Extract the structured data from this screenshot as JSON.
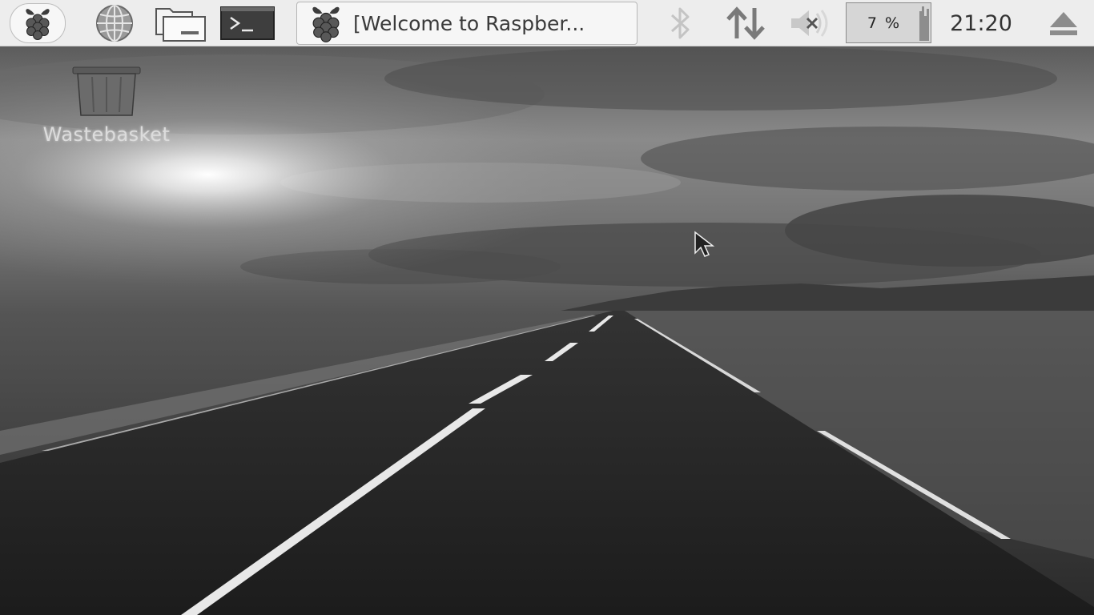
{
  "taskbar": {
    "menu_icon": "raspberry-icon",
    "launchers": [
      {
        "name": "Web Browser",
        "icon": "globe-icon"
      },
      {
        "name": "File Manager",
        "icon": "folder-icon"
      },
      {
        "name": "Terminal",
        "icon": "terminal-icon"
      }
    ],
    "tasks": [
      {
        "label": "[Welcome to Raspber...",
        "icon": "raspberry-icon"
      }
    ],
    "tray": {
      "bluetooth_icon": "bluetooth-icon",
      "network_icon": "network-arrows-icon",
      "volume_icon": "volume-muted-icon",
      "cpu_percent": "7",
      "cpu_unit": "%",
      "clock": "21:20",
      "eject_icon": "eject-icon"
    }
  },
  "desktop": {
    "icons": [
      {
        "label": "Wastebasket",
        "icon": "wastebasket-icon"
      }
    ],
    "wallpaper": "road to horizon (grayscale)"
  },
  "colors": {
    "taskbar_bg": "#ededed",
    "text": "#333333"
  }
}
